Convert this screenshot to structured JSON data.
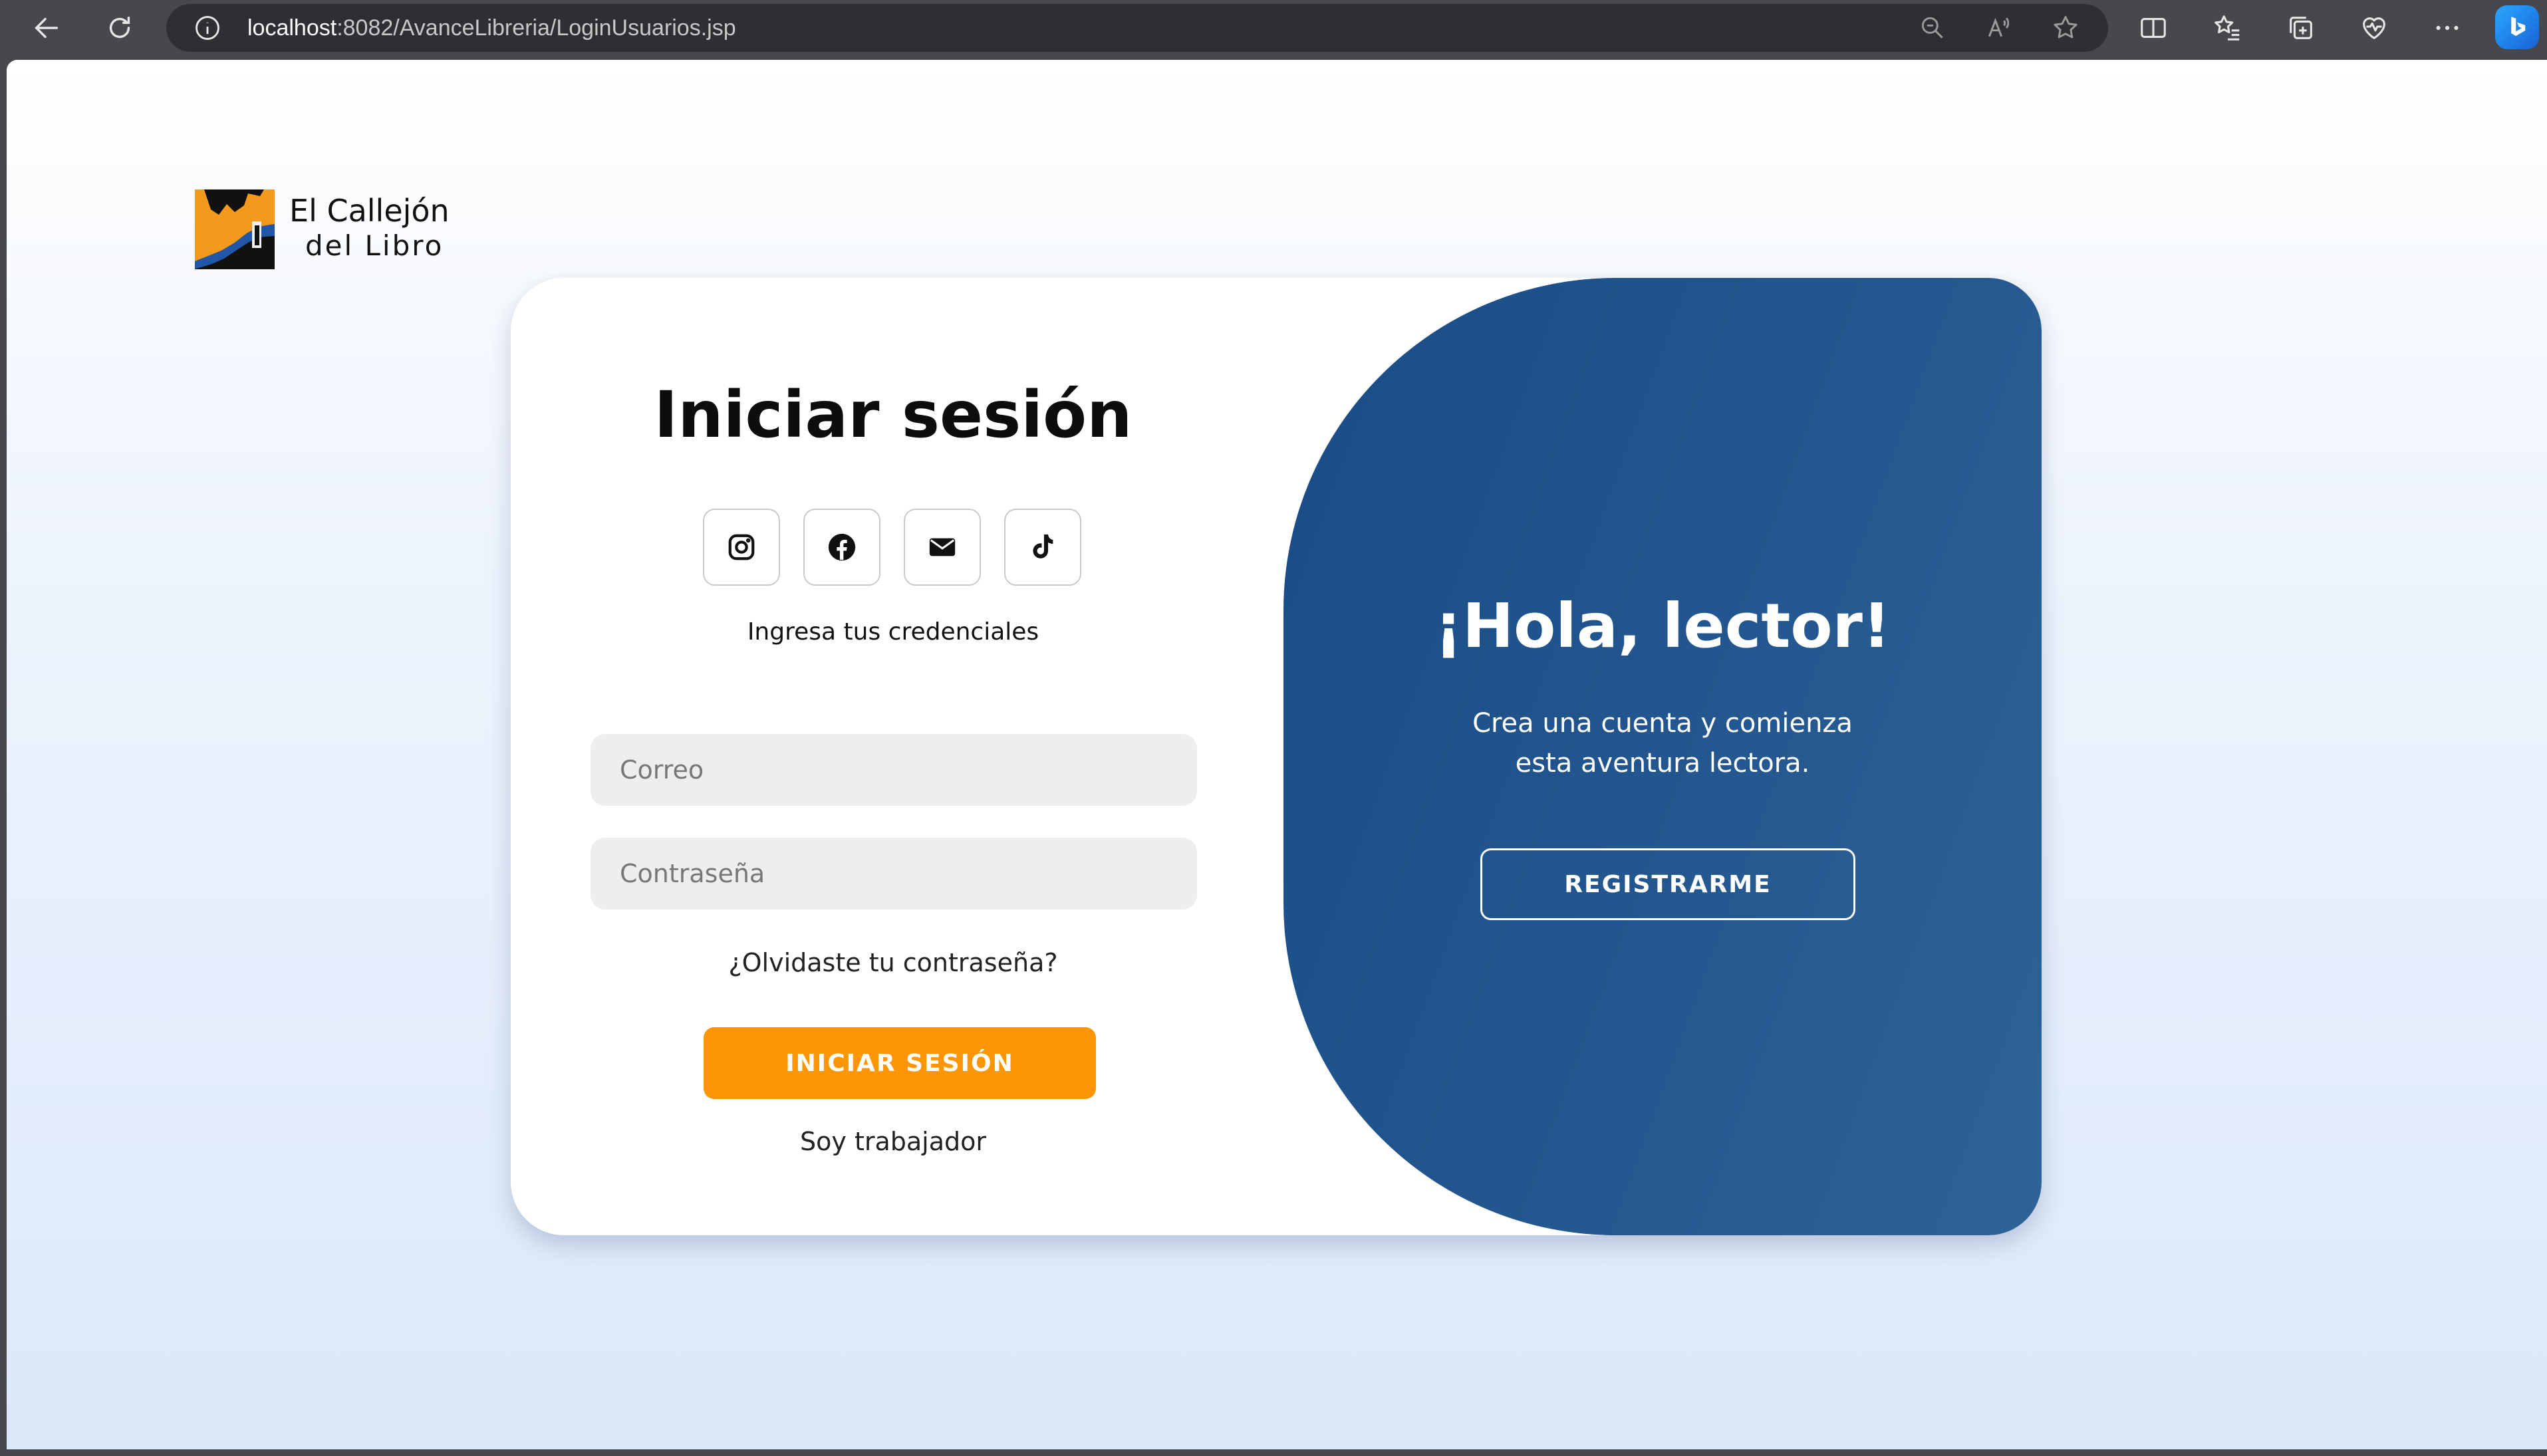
{
  "browser": {
    "url_host": "localhost",
    "url_path": ":8082/AvanceLibreria/LoginUsuarios.jsp"
  },
  "brand": {
    "line1": "El Callejón",
    "line2": "del Libro",
    "colors": {
      "orange": "#f39a1c",
      "blue": "#1c4a86"
    }
  },
  "login": {
    "title": "Iniciar sesión",
    "socials": [
      "instagram-icon",
      "facebook-icon",
      "envelope-icon",
      "tiktok-icon"
    ],
    "credentials_label": "Ingresa tus credenciales",
    "email_placeholder": "Correo",
    "password_placeholder": "Contraseña",
    "forgot_link": "¿Olvidaste tu contraseña?",
    "submit_label": "INICIAR SESIÓN",
    "worker_link": "Soy trabajador",
    "accent_color": "#fd9606"
  },
  "welcome": {
    "title": "¡Hola, lector!",
    "line1": "Crea una cuenta y comienza",
    "line2": "esta aventura lectora.",
    "register_label": "REGISTRARME",
    "panel_color": "#1f5189"
  }
}
